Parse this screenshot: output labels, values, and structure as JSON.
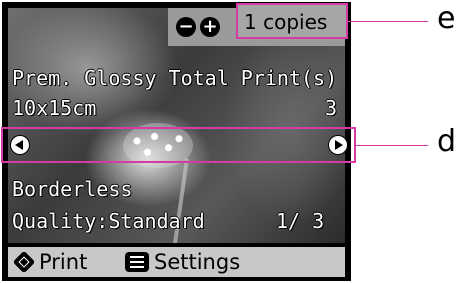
{
  "copies": {
    "minus_icon": "minus-icon",
    "plus_icon": "plus-icon",
    "minus_glyph": "−",
    "plus_glyph": "+",
    "label": "1 copies"
  },
  "info": {
    "paper_type": "Prem. Glossy",
    "total_label": "Total Print(s)",
    "size": "10x15cm",
    "total_count": "3",
    "layout": "Borderless",
    "quality": "Quality:Standard",
    "page_indicator": "1/  3"
  },
  "nav": {
    "left_icon": "left-arrow-icon",
    "right_icon": "right-arrow-icon"
  },
  "bottom_bar": {
    "print_label": "Print",
    "settings_label": "Settings"
  },
  "callouts": {
    "e": "e",
    "d": "d"
  },
  "colors": {
    "highlight": "#d63aa5",
    "bottom_bar": "#c8c8c8",
    "copies_panel": "#9a9a9a"
  }
}
